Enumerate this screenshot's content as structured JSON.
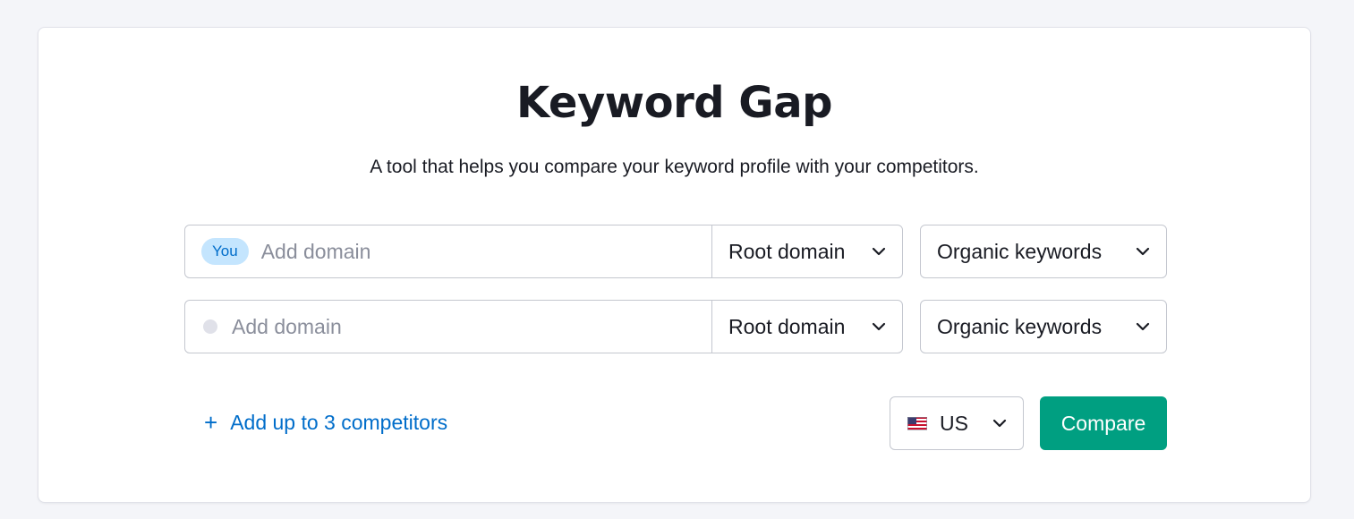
{
  "header": {
    "title": "Keyword Gap",
    "subtitle": "A tool that helps you compare your keyword profile with your competitors."
  },
  "rows": [
    {
      "badge": "You",
      "placeholder": "Add domain",
      "value": "",
      "scope": "Root domain",
      "keyword_type": "Organic keywords"
    },
    {
      "placeholder": "Add domain",
      "value": "",
      "scope": "Root domain",
      "keyword_type": "Organic keywords"
    }
  ],
  "add_competitors": {
    "icon": "plus-icon",
    "label": "Add up to 3 competitors"
  },
  "country": {
    "icon": "us-flag-icon",
    "value": "US"
  },
  "compare_label": "Compare",
  "colors": {
    "accent_green": "#009f81",
    "link_blue": "#006dca",
    "you_badge_bg": "#c4e5fe"
  }
}
